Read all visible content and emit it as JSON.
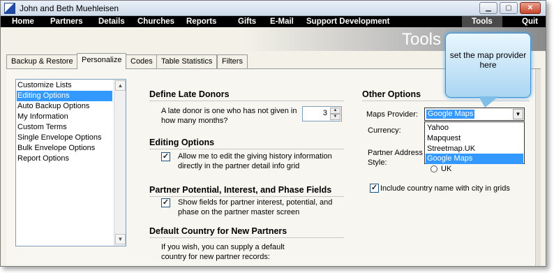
{
  "window": {
    "title": "John and Beth Muehleisen",
    "minimize_icon": "minimize-icon",
    "maximize_icon": "maximize-icon",
    "close_icon": "close-icon"
  },
  "menu": {
    "items": [
      "Home",
      "Partners",
      "Details",
      "Churches",
      "Reports",
      "Gifts",
      "E-Mail",
      "Support Development",
      "Tools",
      "Quit"
    ],
    "active": "Tools"
  },
  "banner": {
    "title": "Tools"
  },
  "tabs": [
    {
      "label": "Backup & Restore",
      "active": false
    },
    {
      "label": "Personalize",
      "active": true
    },
    {
      "label": "Codes",
      "active": false
    },
    {
      "label": "Table Statistics",
      "active": false
    },
    {
      "label": "Filters",
      "active": false
    }
  ],
  "options_list": {
    "items": [
      "Customize Lists",
      "Editing Options",
      "Auto Backup Options",
      "My Information",
      "Custom Terms",
      "Single Envelope Options",
      "Bulk Envelope Options",
      "Report Options"
    ],
    "selected": "Editing Options"
  },
  "late_donors": {
    "heading": "Define Late Donors",
    "question": "A late donor is one who has not given in how many months?",
    "months_value": "3"
  },
  "editing": {
    "heading": "Editing Options",
    "allow_edit_label": "Allow me to edit the giving history information directly in the partner detail info grid",
    "allow_edit_checked": true
  },
  "potential": {
    "heading": "Partner Potential, Interest, and Phase Fields",
    "show_fields_label": "Show fields for partner interest, potential, and phase on the partner master screen",
    "show_fields_checked": true
  },
  "default_country": {
    "heading": "Default Country for New Partners",
    "text": "If you wish, you can supply a default country for new partner records:"
  },
  "other_options": {
    "heading": "Other Options",
    "maps_provider_label": "Maps Provider:",
    "maps_provider_value": "Google Maps",
    "maps_provider_options": [
      "Yahoo",
      "Mapquest",
      "Streetmap.UK",
      "Google Maps"
    ],
    "currency_label": "Currency:",
    "address_style_label": "Partner Address Style:",
    "address_style_option": "UK",
    "include_country_label": "Include country name with city in grids",
    "include_country_checked": true
  },
  "callout": {
    "text": "set the map provider here"
  },
  "colors": {
    "menubar": "#000000",
    "selection": "#3399ff",
    "callout": "#a9d6f2"
  }
}
